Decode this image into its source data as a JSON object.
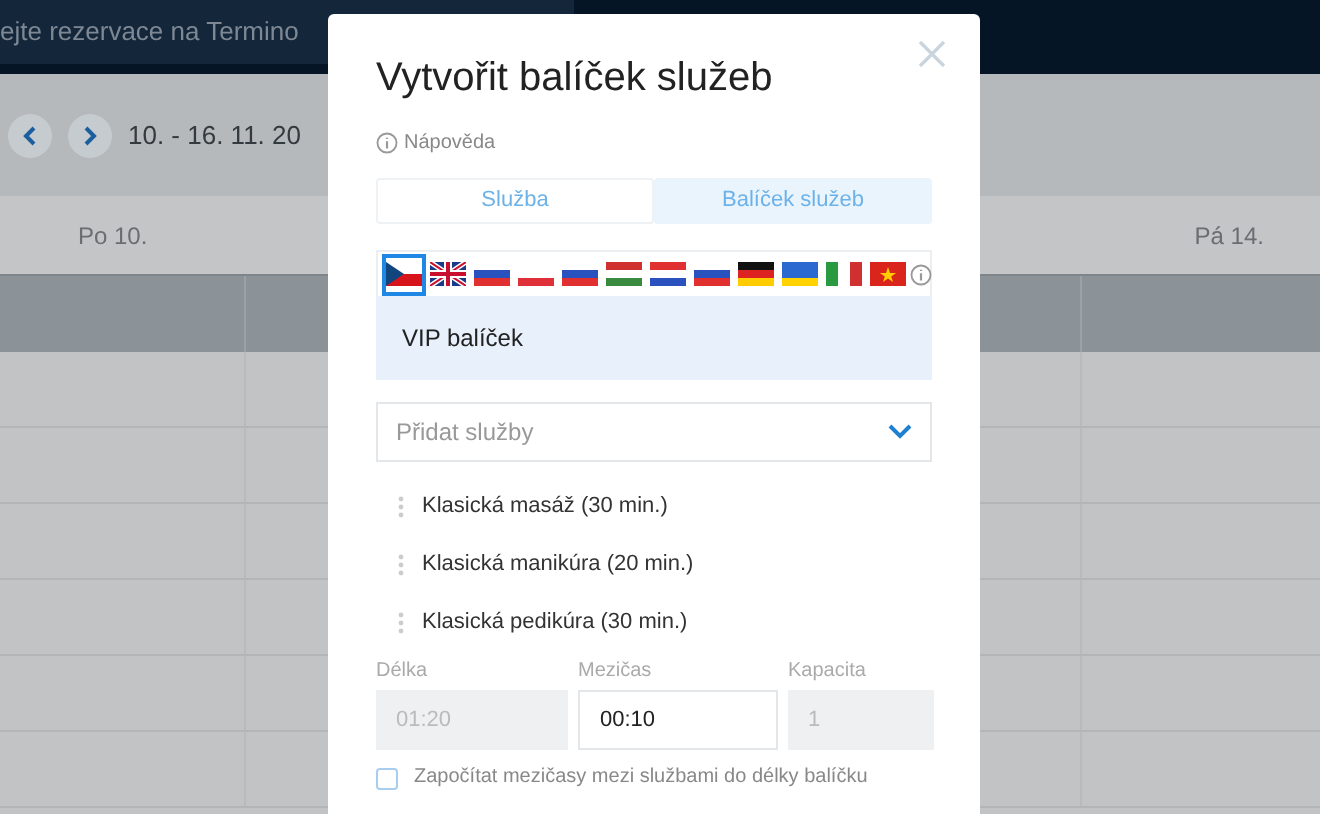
{
  "header": {
    "text": "ejte rezervace na Termino"
  },
  "toolbar": {
    "date_range": "10. - 16. 11. 20"
  },
  "calendar": {
    "days": [
      "Po 10.",
      "Pá 14."
    ]
  },
  "dialog": {
    "title": "Vytvořit balíček služeb",
    "help": "Nápověda",
    "tabs": [
      {
        "label": "Služba",
        "selected": false
      },
      {
        "label": "Balíček služeb",
        "selected": true
      }
    ],
    "languages": [
      {
        "kind": "cz",
        "selected": true
      },
      {
        "kind": "gb",
        "selected": false
      },
      {
        "kind": "sk",
        "selected": false
      },
      {
        "kind": "pl",
        "selected": false
      },
      {
        "kind": "si",
        "selected": false
      },
      {
        "kind": "hu",
        "selected": false
      },
      {
        "kind": "hr",
        "selected": false
      },
      {
        "kind": "ru",
        "selected": false
      },
      {
        "kind": "de",
        "selected": false
      },
      {
        "kind": "ua",
        "selected": false
      },
      {
        "kind": "it",
        "selected": false
      },
      {
        "kind": "vn",
        "selected": false
      }
    ],
    "name": {
      "value": "VIP balíček"
    },
    "add_services": {
      "placeholder": "Přidat služby"
    },
    "services": [
      "Klasická masáž (30 min.)",
      "Klasická manikúra (20 min.)",
      "Klasická pedikúra (30 min.)"
    ],
    "fields": [
      {
        "label": "Délka",
        "value": "01:20",
        "disabled": true
      },
      {
        "label": "Mezičas",
        "value": "00:10",
        "disabled": false
      },
      {
        "label": "Kapacita",
        "value": "1",
        "disabled": true
      }
    ],
    "include_breaks": {
      "label": "Započítat mezičasy mezi službami do délky balíčku",
      "checked": false
    }
  }
}
